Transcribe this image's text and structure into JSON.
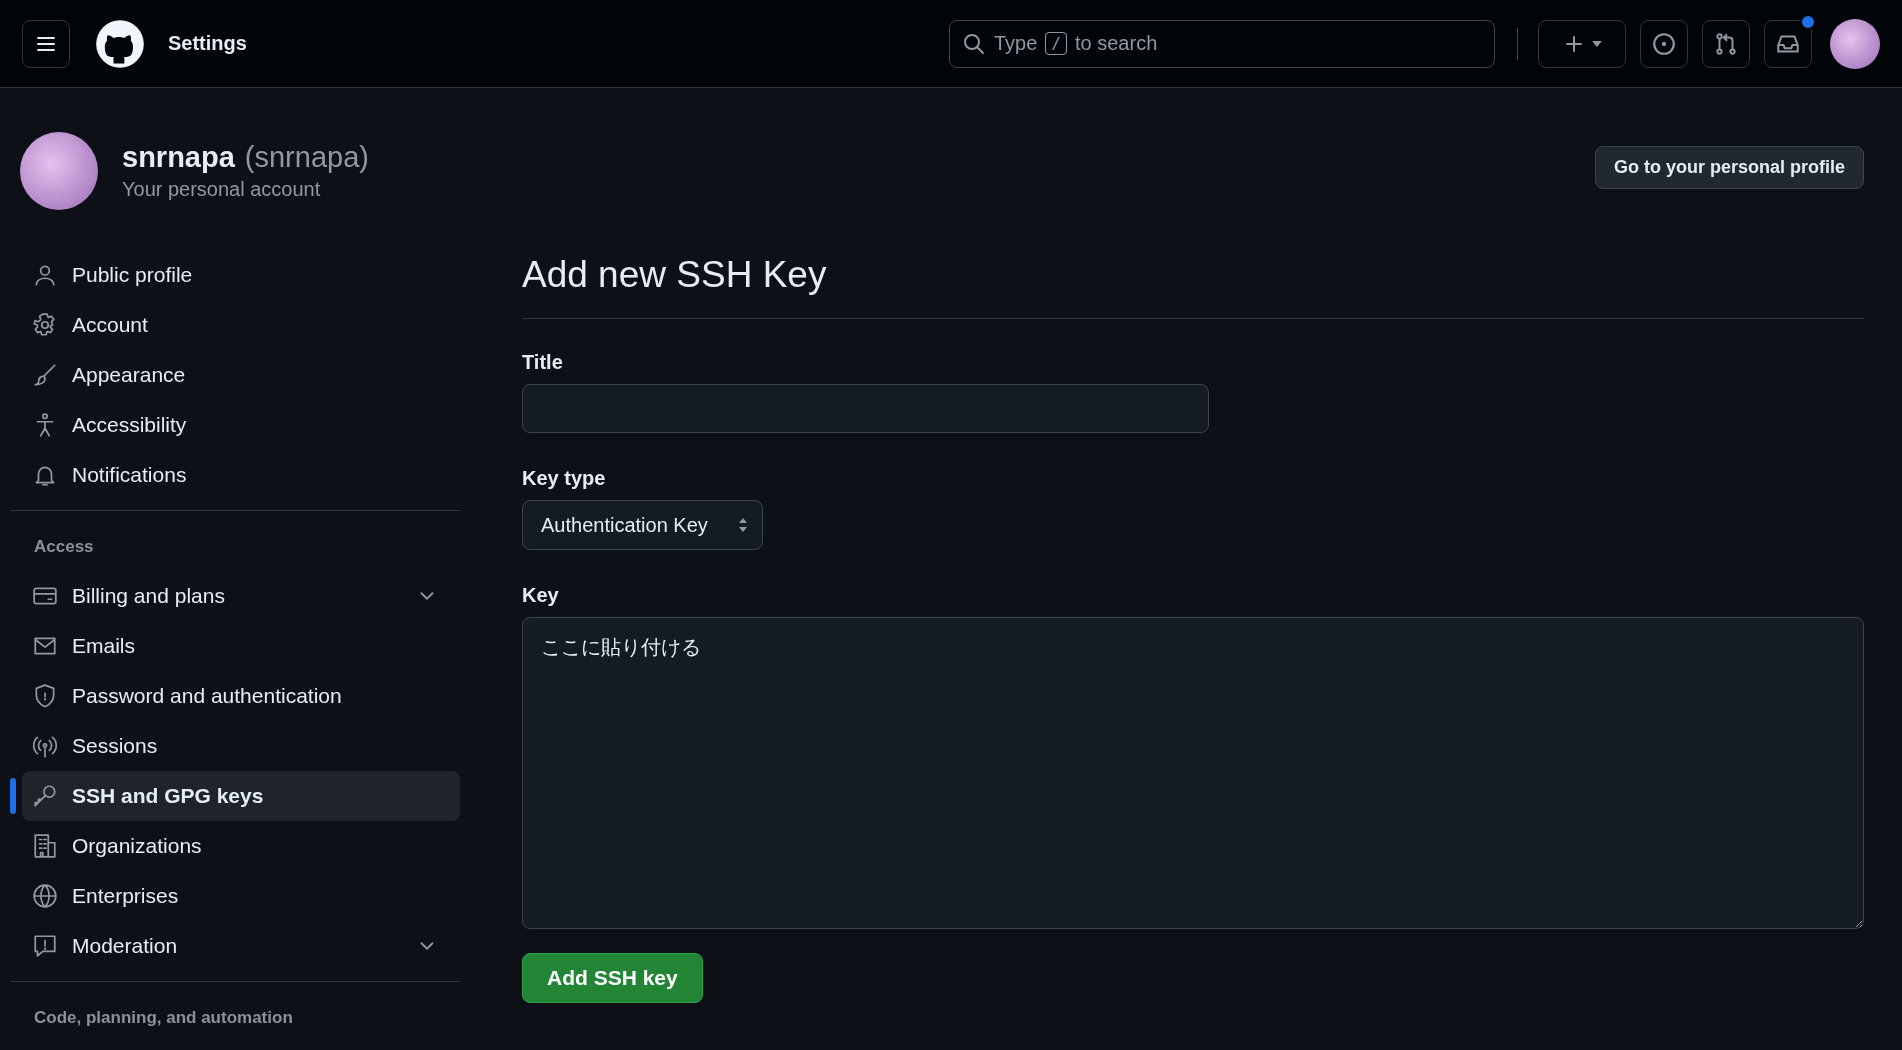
{
  "header": {
    "title": "Settings",
    "search": {
      "prefix": "Type",
      "key": "/",
      "suffix": "to search"
    },
    "inbox_unread": true
  },
  "profile": {
    "name": "snrnapa",
    "login": "(snrnapa)",
    "subtitle": "Your personal account",
    "button": "Go to your personal profile"
  },
  "sidebar": {
    "sections": [
      {
        "items": [
          {
            "label": "Public profile",
            "selected": false,
            "expandable": false
          },
          {
            "label": "Account",
            "selected": false,
            "expandable": false
          },
          {
            "label": "Appearance",
            "selected": false,
            "expandable": false
          },
          {
            "label": "Accessibility",
            "selected": false,
            "expandable": false
          },
          {
            "label": "Notifications",
            "selected": false,
            "expandable": false
          }
        ]
      },
      {
        "heading": "Access",
        "items": [
          {
            "label": "Billing and plans",
            "selected": false,
            "expandable": true
          },
          {
            "label": "Emails",
            "selected": false,
            "expandable": false
          },
          {
            "label": "Password and authentication",
            "selected": false,
            "expandable": false
          },
          {
            "label": "Sessions",
            "selected": false,
            "expandable": false
          },
          {
            "label": "SSH and GPG keys",
            "selected": true,
            "expandable": false
          },
          {
            "label": "Organizations",
            "selected": false,
            "expandable": false
          },
          {
            "label": "Enterprises",
            "selected": false,
            "expandable": false
          },
          {
            "label": "Moderation",
            "selected": false,
            "expandable": true
          }
        ]
      },
      {
        "heading": "Code, planning, and automation"
      }
    ]
  },
  "form": {
    "heading": "Add new SSH Key",
    "title": {
      "label": "Title"
    },
    "key_type": {
      "label": "Key type",
      "value": "Authentication Key"
    },
    "key": {
      "label": "Key",
      "value": "ここに貼り付ける"
    },
    "submit": "Add SSH key"
  }
}
